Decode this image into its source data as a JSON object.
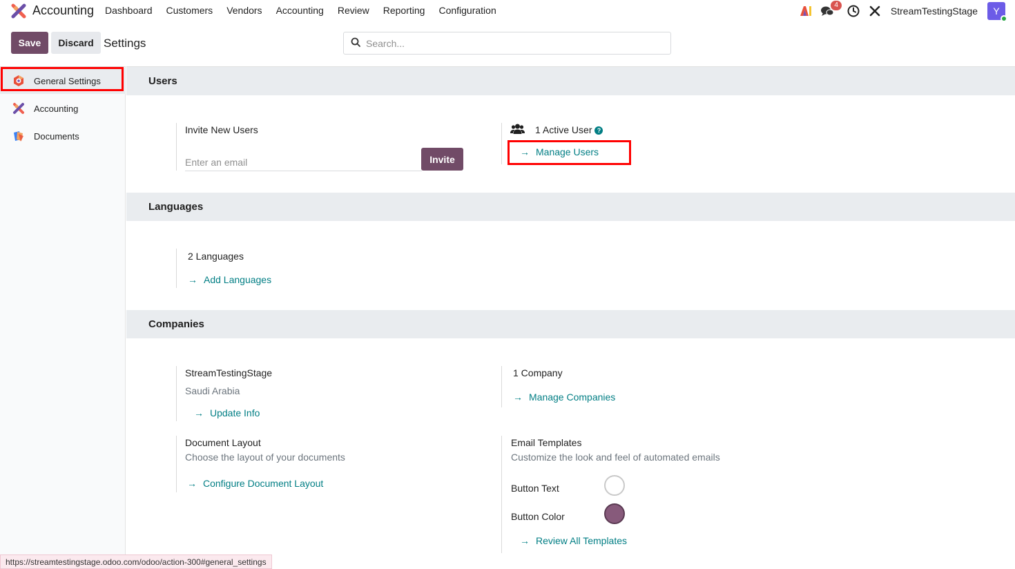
{
  "navbar": {
    "app_name": "Accounting",
    "menu": [
      "Dashboard",
      "Customers",
      "Vendors",
      "Accounting",
      "Review",
      "Reporting",
      "Configuration"
    ],
    "messages_badge": "4",
    "company": "StreamTestingStage",
    "avatar_initial": "Y",
    "icons": [
      "ai-icon",
      "chat-icon",
      "clock-icon",
      "tools-icon"
    ]
  },
  "control": {
    "save_label": "Save",
    "discard_label": "Discard",
    "title": "Settings",
    "search_placeholder": "Search..."
  },
  "sidebar": {
    "items": [
      {
        "label": "General Settings",
        "icon": "settings-icon",
        "active": true
      },
      {
        "label": "Accounting",
        "icon": "accounting-icon"
      },
      {
        "label": "Documents",
        "icon": "documents-icon"
      }
    ]
  },
  "users": {
    "heading": "Users",
    "invite_label": "Invite New Users",
    "email_placeholder": "Enter an email",
    "invite_button": "Invite",
    "active_users": "1 Active User",
    "manage_users": "Manage Users"
  },
  "languages": {
    "heading": "Languages",
    "count": "2 Languages",
    "add_link": "Add Languages"
  },
  "companies": {
    "heading": "Companies",
    "company_name": "StreamTestingStage",
    "country": "Saudi Arabia",
    "update_info": "Update Info",
    "company_count": "1 Company",
    "manage_companies": "Manage Companies",
    "doc_layout_title": "Document Layout",
    "doc_layout_desc": "Choose the layout of your documents",
    "configure_layout": "Configure Document Layout",
    "email_templates_title": "Email Templates",
    "email_templates_desc": "Customize the look and feel of automated emails",
    "button_text_label": "Button Text",
    "button_color_label": "Button Color",
    "button_text_color": "#ffffff",
    "button_color": "#875a7b",
    "review_templates": "Review All Templates"
  },
  "status_bar": {
    "url": "https://streamtestingstage.odoo.com/odoo/action-300#general_settings"
  }
}
